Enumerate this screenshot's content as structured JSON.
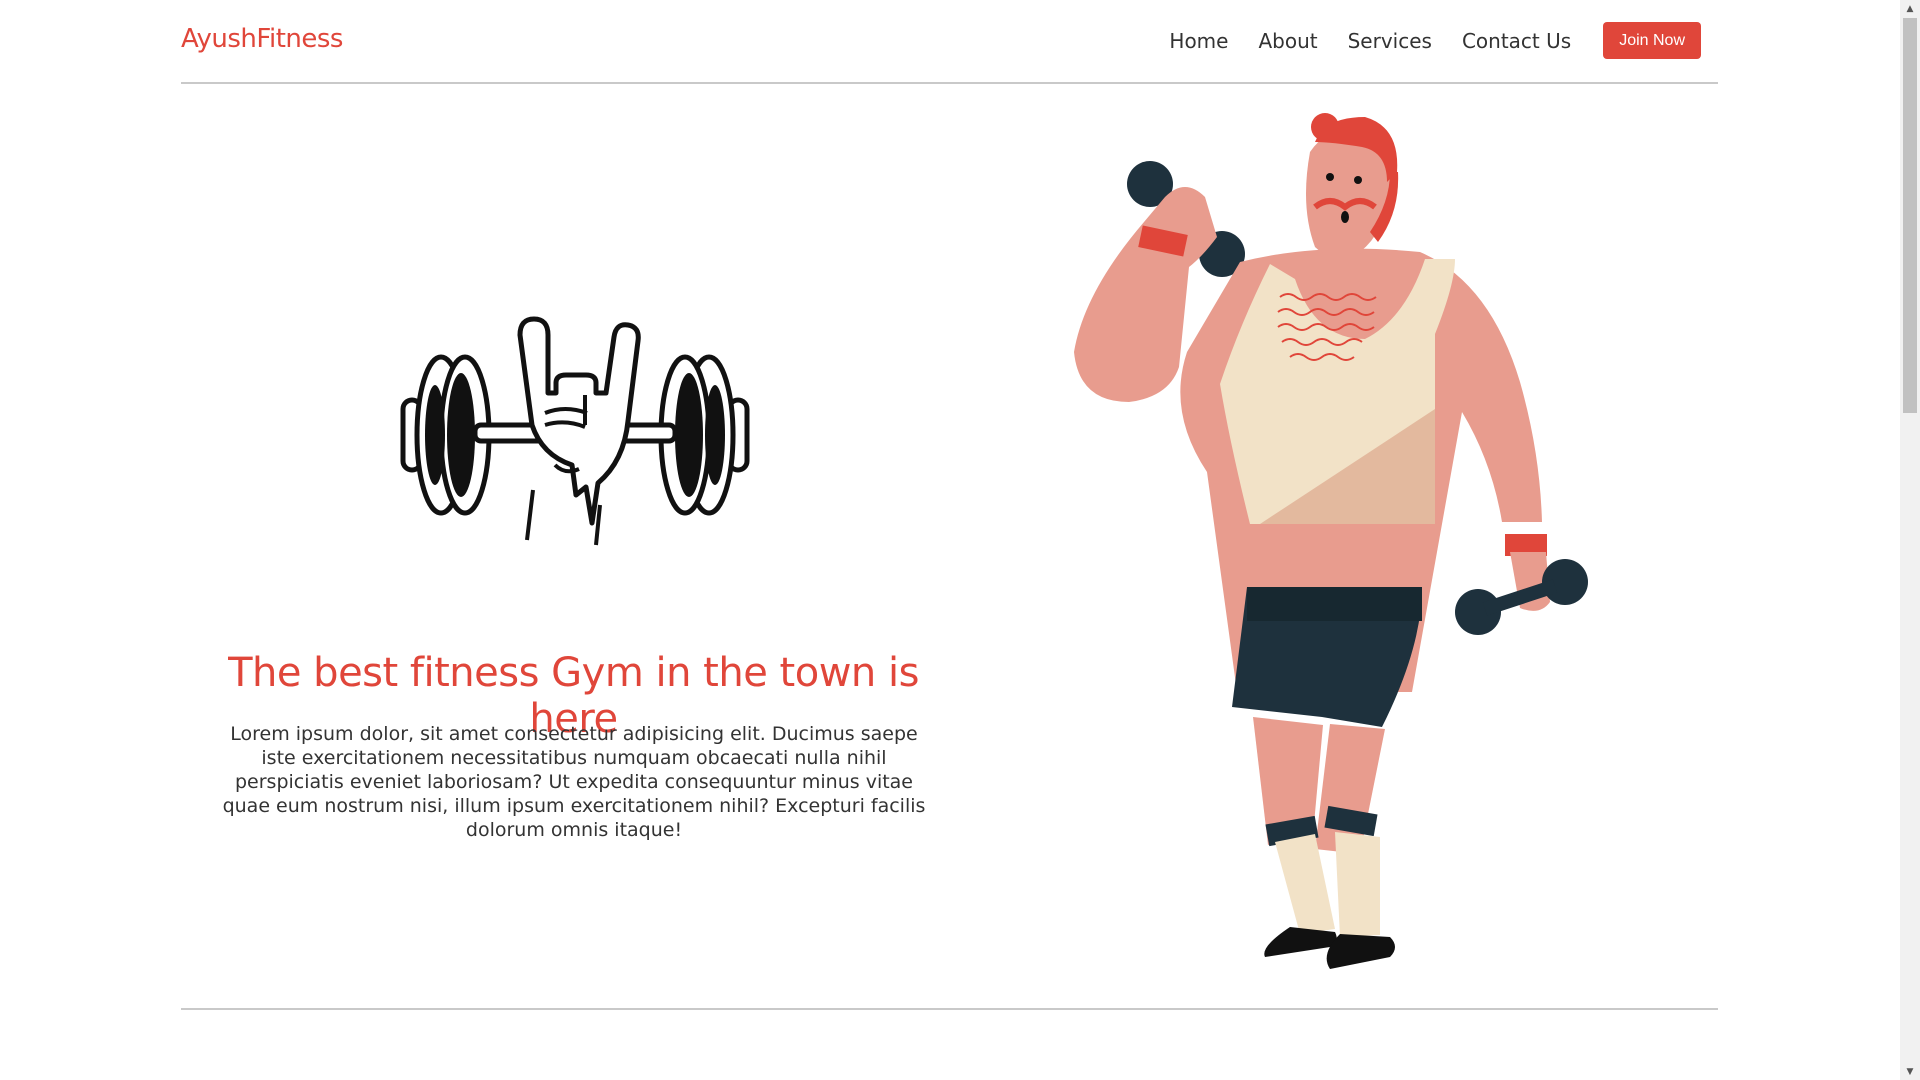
{
  "brand": "AyushFitness",
  "nav": {
    "links": [
      "Home",
      "About",
      "Services",
      "Contact Us"
    ],
    "cta": "Join Now"
  },
  "hero": {
    "title": "The best fitness Gym in the town is here",
    "text": "Lorem ipsum dolor, sit amet consectetur adipisicing elit. Ducimus saepe iste exercitationem necessitatibus numquam obcaecati nulla nihil perspiciatis eveniet laboriosam? Ut expedita consequuntur minus vitae quae eum nostrum nisi, illum ipsum exercitationem nihil? Excepturi facilis dolorum omnis itaque!"
  },
  "icons": {
    "logo": "barbell-rock-hand-icon",
    "illustration": "bodybuilder-with-dumbbells-illustration"
  },
  "colors": {
    "accent": "#e0463a",
    "text": "#333333",
    "divider": "#c9c9c9"
  }
}
